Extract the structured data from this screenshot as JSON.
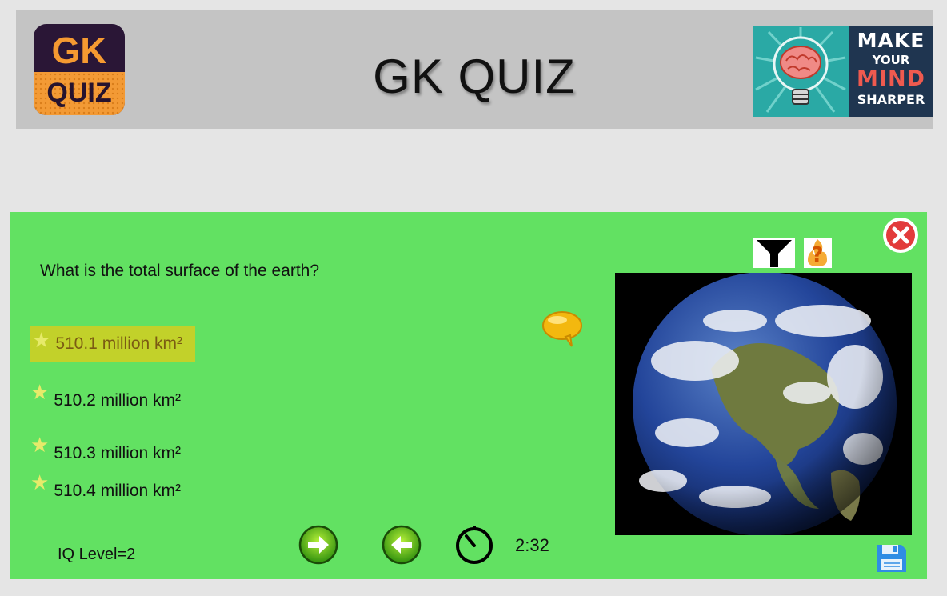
{
  "header": {
    "logo": {
      "line1": "GK",
      "line2": "QUIZ"
    },
    "title": "GK QUIZ",
    "banner": {
      "line1": "MAKE",
      "line2": "YOUR",
      "line3": "MIND",
      "line4": "SHARPER",
      "icon": "lightbulb-brain-icon"
    }
  },
  "quiz": {
    "question": "What is the total surface of the earth?",
    "options": [
      {
        "label": "510.1 million km²",
        "selected": true
      },
      {
        "label": "510.2 million km²",
        "selected": false
      },
      {
        "label": "510.3 million km²",
        "selected": false
      },
      {
        "label": "510.4 million km²",
        "selected": false
      }
    ],
    "image": "earth-globe",
    "timer": "2:32",
    "iq_level": "IQ Level=2"
  },
  "icons": {
    "close": "close-icon",
    "filter": "filter-icon",
    "help": "help-icon",
    "hint": "speech-bubble-icon",
    "next": "arrow-right-icon",
    "prev": "arrow-left-icon",
    "timer": "stopwatch-icon",
    "save": "floppy-save-icon"
  },
  "colors": {
    "panel": "#62e162",
    "selected_option": "#c2d12a",
    "header": "#c4c4c4"
  }
}
